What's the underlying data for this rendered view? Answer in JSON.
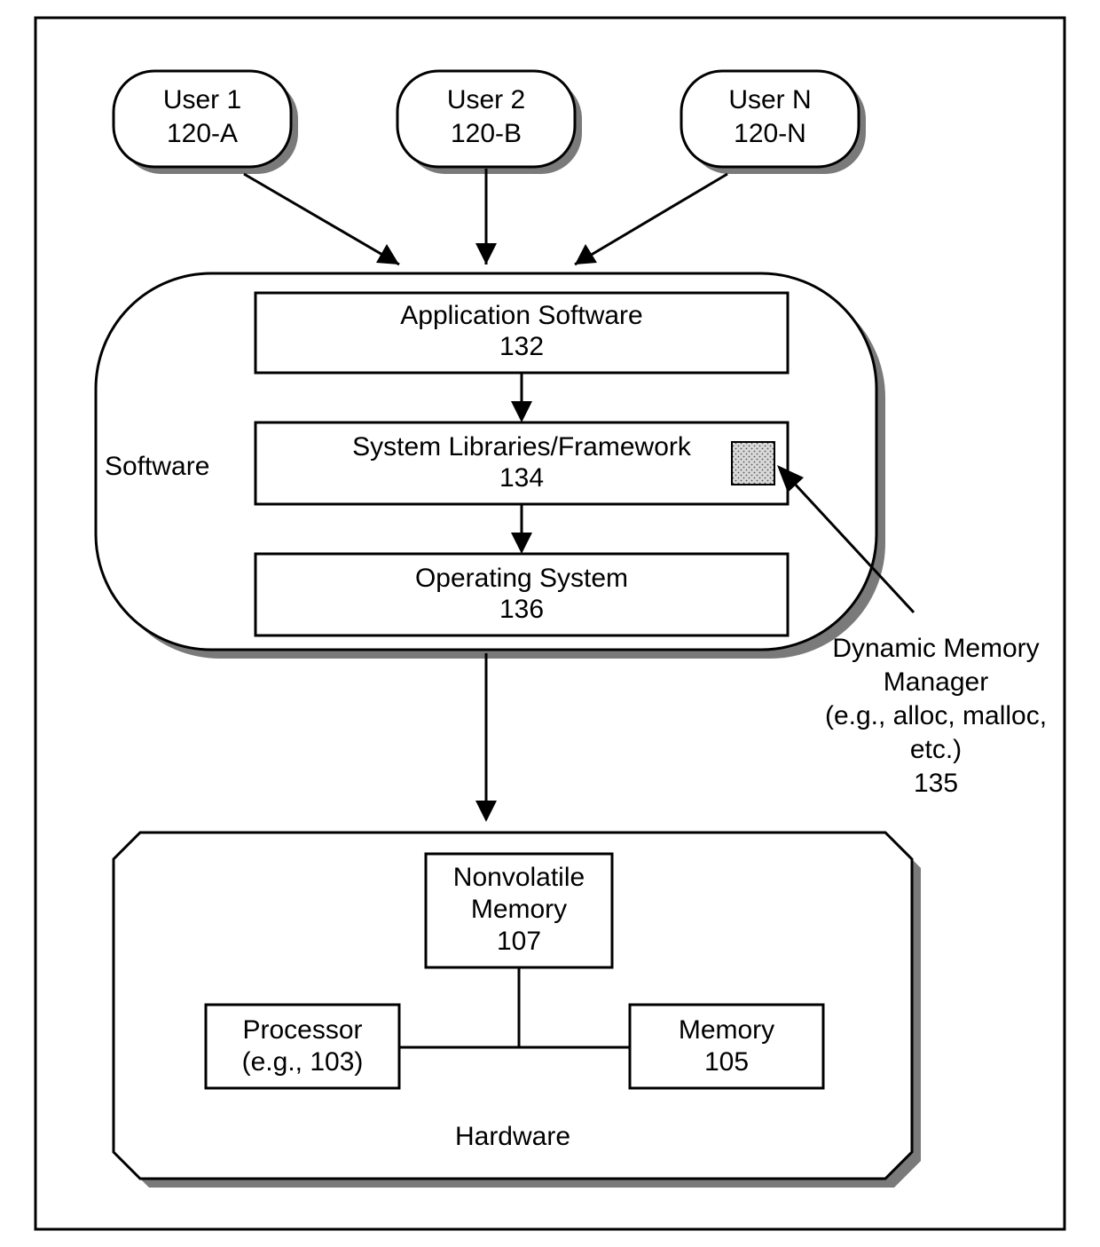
{
  "users": [
    {
      "name": "User 1",
      "id": "120-A"
    },
    {
      "name": "User 2",
      "id": "120-B"
    },
    {
      "name": "User N",
      "id": "120-N"
    }
  ],
  "software": {
    "label": "Software",
    "app": {
      "name": "Application Software",
      "id": "132"
    },
    "libs": {
      "name": "System Libraries/Framework",
      "id": "134"
    },
    "os": {
      "name": "Operating System",
      "id": "136"
    }
  },
  "dmm": {
    "line1": "Dynamic Memory",
    "line2": "Manager",
    "line3": "(e.g., alloc, malloc,",
    "line4": "etc.)",
    "id": "135"
  },
  "hardware": {
    "label": "Hardware",
    "nvmem": {
      "name": "Nonvolatile",
      "name2": "Memory",
      "id": "107"
    },
    "proc": {
      "name": "Processor",
      "sub": "(e.g., 103)"
    },
    "mem": {
      "name": "Memory",
      "id": "105"
    }
  }
}
